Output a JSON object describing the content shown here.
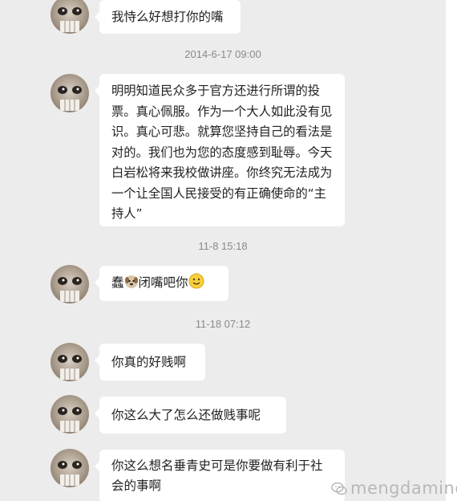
{
  "messages": [
    {
      "text": "我恃么好想打你的嘴"
    },
    {
      "text": "明明知道民众多于官方还进行所谓的投票。真心佩服。作为一个大人如此没有见识。真心可悲。就算您坚持自己的看法是对的。我们也为您的态度感到耻辱。今天白岩松将来我校做讲座。你终究无法成为一个让全国人民接受的有正确使命的“主持人”"
    },
    {
      "text_before": "蠢",
      "text_after": "闭嘴吧你",
      "emojis": [
        "dog-emoji",
        "smile-emoji"
      ]
    },
    {
      "text": "你真的好贱啊"
    },
    {
      "text": "你这么大了怎么还做贱事呢"
    },
    {
      "text": "你这么想名垂青史可是你要做有利于社会的事啊"
    }
  ],
  "timestamps": [
    "2014-6-17 09:00",
    "11-8 15:18",
    "11-18 07:12"
  ],
  "watermark": {
    "text": "mengdaming",
    "icon": "wechat-icon"
  },
  "colors": {
    "background": "#ececec",
    "bubble": "#ffffff",
    "timestamp": "#8a8a8a",
    "text": "#222222"
  }
}
